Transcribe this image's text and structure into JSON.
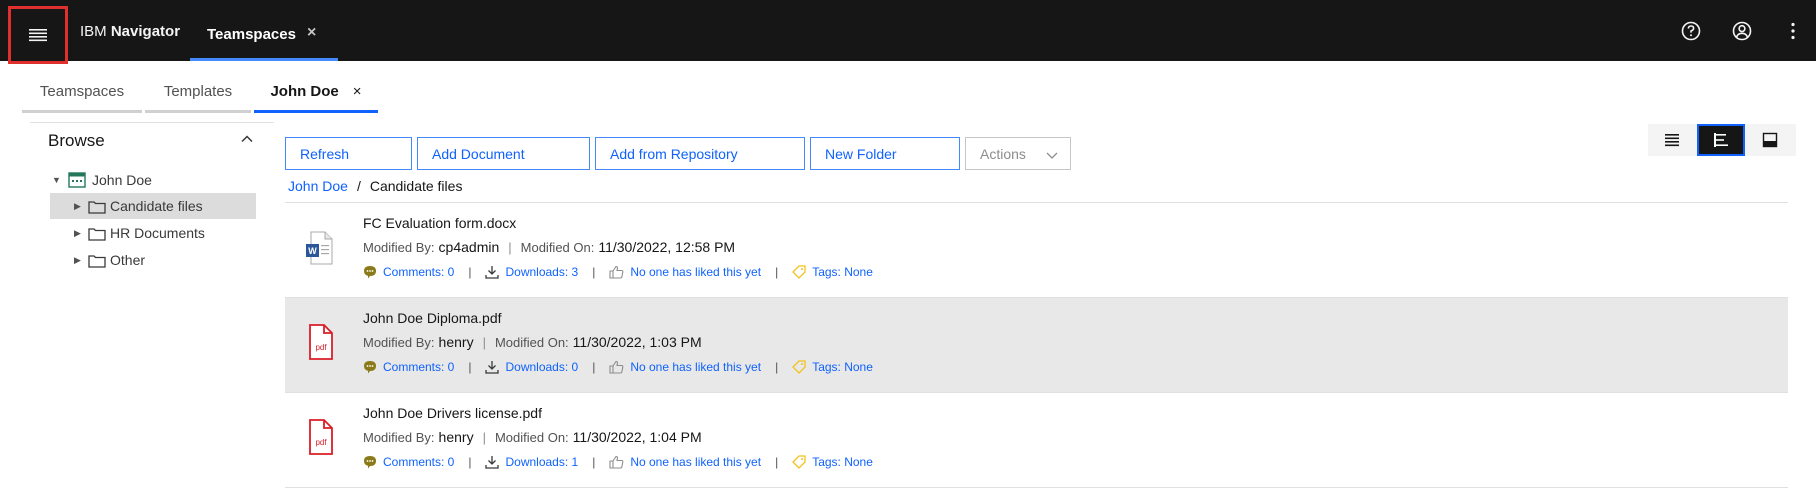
{
  "topbar": {
    "brand_prefix": "IBM",
    "brand_name": "Navigator",
    "tab_label": "Teamspaces",
    "tab_close": "×"
  },
  "subtabs": [
    {
      "label": "Teamspaces"
    },
    {
      "label": "Templates"
    },
    {
      "label": "John Doe",
      "close": "×"
    }
  ],
  "sidebar": {
    "heading": "Browse",
    "tree": [
      {
        "label": "John Doe"
      },
      {
        "label": "Candidate files"
      },
      {
        "label": "HR Documents"
      },
      {
        "label": "Other"
      }
    ]
  },
  "toolbar": {
    "refresh": "Refresh",
    "add_document": "Add Document",
    "add_from_repository": "Add from Repository",
    "new_folder": "New Folder",
    "actions": "Actions"
  },
  "breadcrumb": {
    "root": "John Doe",
    "separator": "/",
    "current": "Candidate files"
  },
  "labels": {
    "modified_by": "Modified By:",
    "modified_on": "Modified On:",
    "pipe": "|"
  },
  "documents": [
    {
      "name": "FC Evaluation form.docx",
      "icon": "word-document-icon",
      "modified_by": "cp4admin",
      "modified_on": "11/30/2022, 12:58 PM",
      "comments": "Comments: 0",
      "downloads": "Downloads: 3",
      "likes": "No one has liked this yet",
      "tags": "Tags: None"
    },
    {
      "name": "John Doe Diploma.pdf",
      "icon": "pdf-icon",
      "modified_by": "henry",
      "modified_on": "11/30/2022, 1:03 PM",
      "comments": "Comments: 0",
      "downloads": "Downloads: 0",
      "likes": "No one has liked this yet",
      "tags": "Tags: None"
    },
    {
      "name": "John Doe Drivers license.pdf",
      "icon": "pdf-icon",
      "modified_by": "henry",
      "modified_on": "11/30/2022, 1:04 PM",
      "comments": "Comments: 0",
      "downloads": "Downloads: 1",
      "likes": "No one has liked this yet",
      "tags": "Tags: None"
    }
  ],
  "colors": {
    "accent": "#0f62fe",
    "topbar": "#161616",
    "highlight_border": "#e0302d",
    "pdf_red": "#da1e28",
    "comment_olive": "#8a7a1a",
    "tag_yellow": "#f1c21b"
  }
}
